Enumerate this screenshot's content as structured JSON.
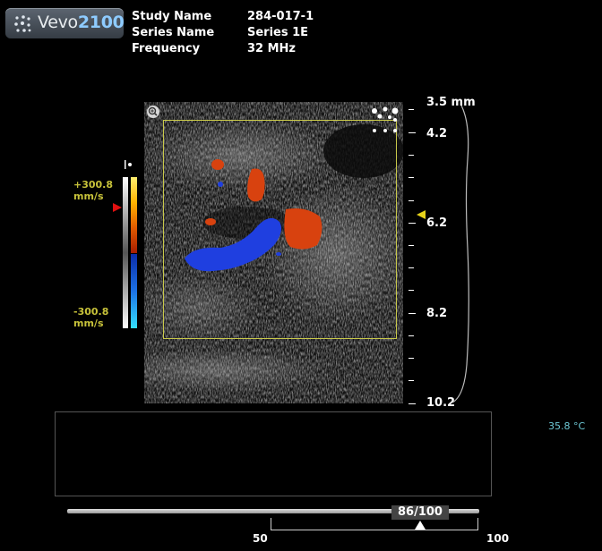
{
  "logo": {
    "brand": "Vevo",
    "model": "2100"
  },
  "study": {
    "fields": [
      {
        "label": "Study Name",
        "value": "284-017-1"
      },
      {
        "label": "Series Name",
        "value": "Series 1E"
      },
      {
        "label": "Frequency",
        "value": "32 MHz"
      }
    ]
  },
  "color_scale": {
    "max": "+300.8",
    "max_unit": "mm/s",
    "min": "-300.8",
    "min_unit": "mm/s"
  },
  "depth_scale": {
    "labels": [
      "3.5 mm",
      "4.2",
      "6.2",
      "8.2",
      "10.2"
    ]
  },
  "temperature": "35.8 °C",
  "frame_slider": {
    "value_text": "86/100",
    "current": 86,
    "total": 100,
    "range_min": "50",
    "range_max": "100"
  },
  "colors": {
    "roi": "#c9c94a",
    "velocity_text": "#c7c23a",
    "temperature_text": "#6ec9d6",
    "doppler_red": "#d8420f",
    "doppler_blue": "#1f3fe0"
  },
  "icons": [
    "zoom-icon",
    "layout-icon",
    "marker-arrow-icon",
    "focus-arrow-icon"
  ]
}
